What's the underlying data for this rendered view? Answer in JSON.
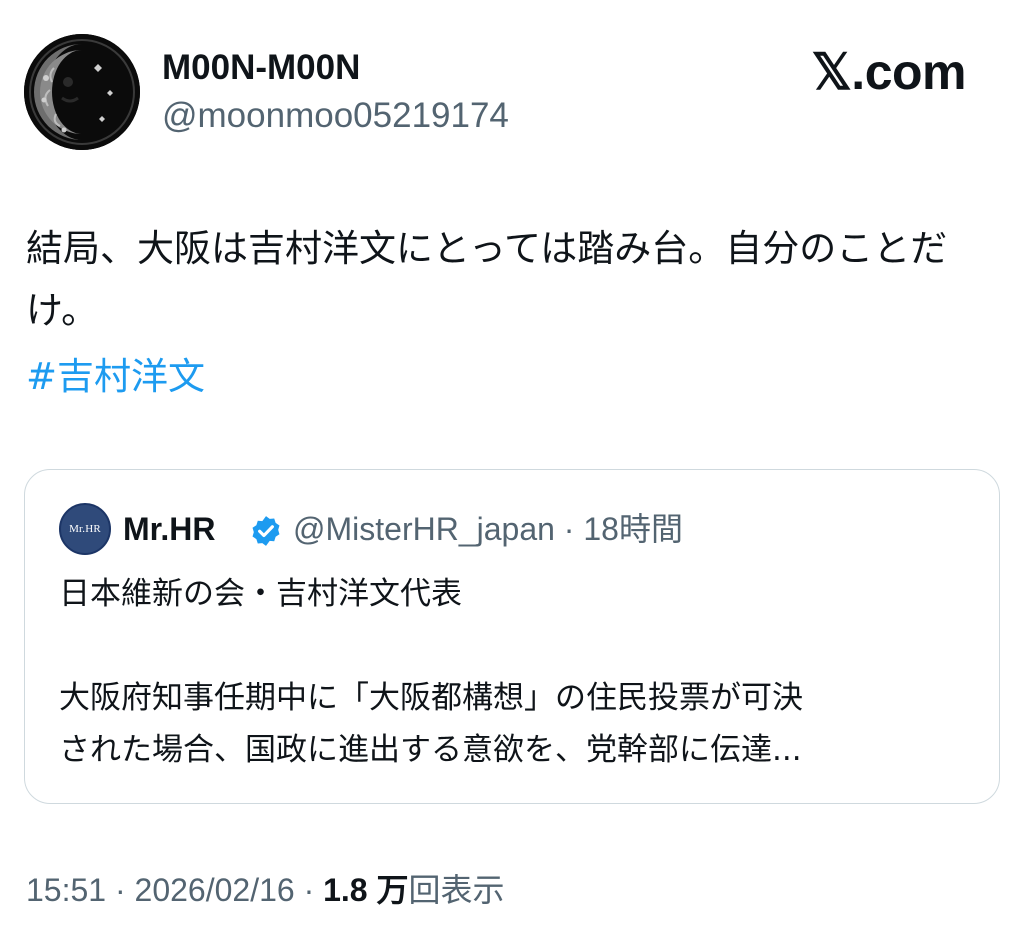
{
  "author": {
    "display_name": "M00N-M00N",
    "handle": "@moonmoo05219174",
    "avatar_icon": "moon-face-avatar"
  },
  "brand": {
    "label": "𝕏.com"
  },
  "tweet": {
    "text": "結局、大阪は吉村洋文にとっては踏み台。自分のことだけ。",
    "hashtag": "#吉村洋文"
  },
  "quote": {
    "avatar_text": "Mr.HR",
    "display_name": "Mr.HR",
    "verified_icon": "verified-badge-icon",
    "handle": "@MisterHR_japan",
    "separator": "·",
    "time": "18時間",
    "line1": "日本維新の会・吉村洋文代表",
    "line2": "大阪府知事任期中に「大阪都構想」の住民投票が可決",
    "line3": "された場合、国政に進出する意欲を、党幹部に伝達..."
  },
  "footer": {
    "time": "15:51",
    "separator": "·",
    "date": "2026/02/16",
    "views_count": "1.8 万",
    "views_label": "回表示"
  },
  "colors": {
    "text": "#0f1419",
    "secondary": "#536471",
    "link": "#1d9bf0",
    "verified": "#1d9bf0",
    "border": "#cfd9de"
  }
}
